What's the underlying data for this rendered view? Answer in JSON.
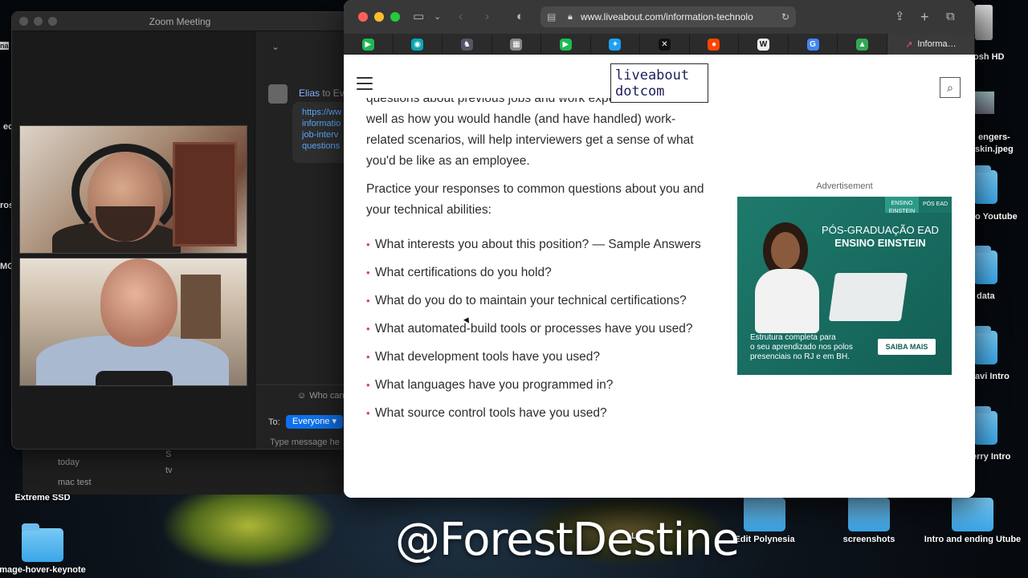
{
  "zoom": {
    "title": "Zoom Meeting",
    "chat": {
      "from": "Elias",
      "to_label": "to Eve",
      "link_lines": [
        "https://ww",
        "informatio",
        "job-interv",
        "questions"
      ],
      "who_can_see": "Who can",
      "to": "To:",
      "recipient": "Everyone",
      "input_placeholder": "Type message he"
    }
  },
  "finder": {
    "rows": [
      "today",
      "mac test",
      "S",
      "tv"
    ]
  },
  "browser": {
    "url": "www.liveabout.com/information-technolo",
    "active_tab": "Informa…",
    "tabs": [
      {
        "icon": "green-play-icon",
        "color": "#1db954"
      },
      {
        "icon": "teal-circle-icon",
        "color": "#0aa6b5"
      },
      {
        "icon": "shield-bird-icon",
        "color": "#556"
      },
      {
        "icon": "reader-icon",
        "color": "#888"
      },
      {
        "icon": "green-play-icon",
        "color": "#1db954"
      },
      {
        "icon": "twitter-icon",
        "color": "#1da1f2"
      },
      {
        "icon": "x-box-icon",
        "color": "#111"
      },
      {
        "icon": "reddit-icon",
        "color": "#ff4500"
      },
      {
        "icon": "wikipedia-icon",
        "color": "#eee"
      },
      {
        "icon": "google-icon",
        "color": "#4285f4"
      },
      {
        "icon": "drive-icon",
        "color": "#34a853"
      }
    ],
    "logo_line1": "liveabout",
    "logo_line2": "dotcom",
    "article": {
      "clipped_line": "questions about previous jobs and work experience as",
      "para1": "well as how you would handle (and have handled) work-related scenarios, will help interviewers get a sense of what you'd be like as an employee.",
      "para2": "Practice your responses to common questions about you and your technical abilities:",
      "bullets": [
        "What interests you about this position? — Sample Answers",
        "What certifications do you hold?",
        "What do you do to maintain your technical certifications?",
        "What automated-build tools or processes have you used?",
        "What development tools have you used?",
        "What languages have you programmed in?",
        "What source control tools have you used?"
      ]
    },
    "ad": {
      "label": "Advertisement",
      "tag1": "ENSINO EINSTEIN",
      "tag2": "PÓS EAD",
      "headline1": "PÓS-GRADUAÇÃO EAD",
      "headline2": "ENSINO EINSTEIN",
      "copy": [
        "Estrutura completa para",
        "o seu aprendizado nos polos",
        "presenciais no RJ e em BH."
      ],
      "button": "SAIBA MAIS"
    }
  },
  "desktop": {
    "items": [
      {
        "label": "Extreme SSD"
      },
      {
        "label": "mage-hover-keynote"
      },
      {
        "label": "Edit Polynesia"
      },
      {
        "label": "screenshots"
      },
      {
        "label": "Intro and ending Utube"
      },
      {
        "label": "L"
      }
    ],
    "right_partials": [
      "osh HD",
      "engers-",
      "skin.jpeg",
      "o Youtube",
      "data",
      "avi Intro",
      "erry Intro"
    ],
    "left_partials": [
      "ec",
      "ros",
      "MG",
      "na"
    ]
  },
  "watermark": "@ForestDestine"
}
